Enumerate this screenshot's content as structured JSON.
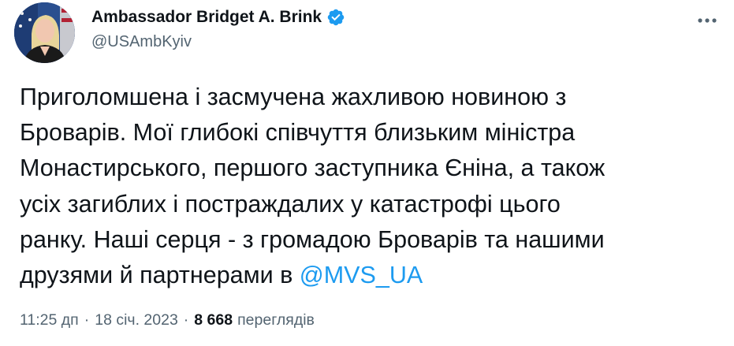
{
  "author": {
    "display_name": "Ambassador Bridget A. Brink",
    "handle": "@USAmbKyiv",
    "verified": true,
    "avatar_icon": "profile-photo"
  },
  "tweet": {
    "lines": [
      "Приголомшена і засмучена жахливою новиною з",
      "Броварів. Мої глибокі співчуття близьким міністра",
      "Монастирського, першого заступника Єніна, а також",
      "усіх загиблих і постраждалих у катастрофі цього",
      "ранку. Наші серця - з громадою Броварів та нашими",
      "друзями й партнерами в "
    ],
    "mention": "@MVS_UA"
  },
  "meta": {
    "time": "11:25 дп",
    "separator": "·",
    "date": "18 січ. 2023",
    "views_count": "8 668",
    "views_label": "переглядів"
  },
  "colors": {
    "text": "#0f1419",
    "secondary": "#536471",
    "link": "#1d9bf0",
    "verified_badge": "#1d9bf0"
  }
}
